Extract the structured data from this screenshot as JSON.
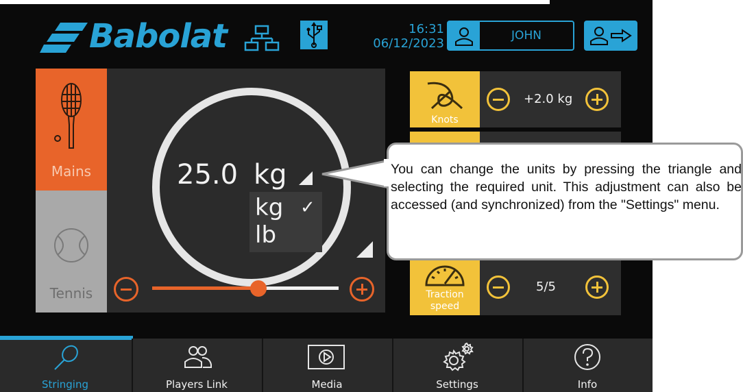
{
  "header": {
    "brand": "Babolat",
    "time": "16:31",
    "date": "06/12/2023",
    "user": "JOHN",
    "icons": [
      "network-icon",
      "usb-icon",
      "user-icon",
      "logout-icon"
    ]
  },
  "tension_panel": {
    "tabs": [
      {
        "label": "Mains",
        "icon": "racket-icon",
        "active": true
      },
      {
        "label": "Tennis",
        "icon": "tennis-ball-icon",
        "active": false
      }
    ],
    "value": "25.0",
    "unit": "kg",
    "unit_options": [
      "kg",
      "lb"
    ],
    "selected_unit": "kg",
    "check_mark": "✓",
    "slider_fraction": 0.57
  },
  "settings_rows": [
    {
      "label": "Knots",
      "icon": "knot-icon",
      "value": "+2.0 kg"
    },
    {
      "label": "Traction speed",
      "icon": "speedometer-icon",
      "value": "5/5"
    }
  ],
  "callout": {
    "text": "You can change the units by pressing the triangle and selecting the required unit. This adjustment can also be accessed (and synchronized) from the \"Settings\" menu."
  },
  "nav": [
    {
      "label": "Stringing",
      "icon": "racket-outline-icon",
      "active": true
    },
    {
      "label": "Players Link",
      "icon": "players-icon",
      "active": false
    },
    {
      "label": "Media",
      "icon": "play-icon",
      "active": false
    },
    {
      "label": "Settings",
      "icon": "gears-icon",
      "active": false
    },
    {
      "label": "Info",
      "icon": "question-icon",
      "active": false
    }
  ],
  "colors": {
    "accent_blue": "#29a3d6",
    "orange": "#e8642a",
    "yellow": "#f2c23a",
    "background": "#0a0a0a"
  }
}
